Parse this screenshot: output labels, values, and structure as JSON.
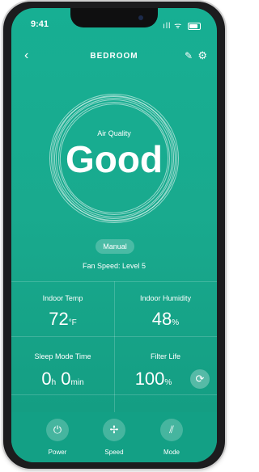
{
  "status_bar": {
    "time": "9:41",
    "signal": "ıll",
    "wifi": "ᯤ"
  },
  "header": {
    "title": "BEDROOM",
    "back_icon": "‹",
    "edit_icon": "✎",
    "settings_icon": "⚙"
  },
  "air_quality": {
    "label": "Air Quality",
    "value": "Good"
  },
  "mode": {
    "label": "Manual"
  },
  "fan_speed": {
    "text": "Fan Speed: Level 5"
  },
  "stats": {
    "indoor_temp": {
      "label": "Indoor Temp",
      "value": "72",
      "unit": "°F"
    },
    "indoor_humidity": {
      "label": "Indoor Humidity",
      "value": "48",
      "unit": "%"
    },
    "sleep_mode_time": {
      "label": "Sleep Mode Time",
      "h": "0",
      "h_unit": "h",
      "m": "0",
      "m_unit": "min"
    },
    "filter_life": {
      "label": "Filter Life",
      "value": "100",
      "unit": "%"
    }
  },
  "bottom_bar": {
    "power": "Power",
    "speed": "Speed",
    "mode": "Mode"
  },
  "colors": {
    "background": "#17af93",
    "text": "#ffffff",
    "frame": "#1c1c1e"
  }
}
